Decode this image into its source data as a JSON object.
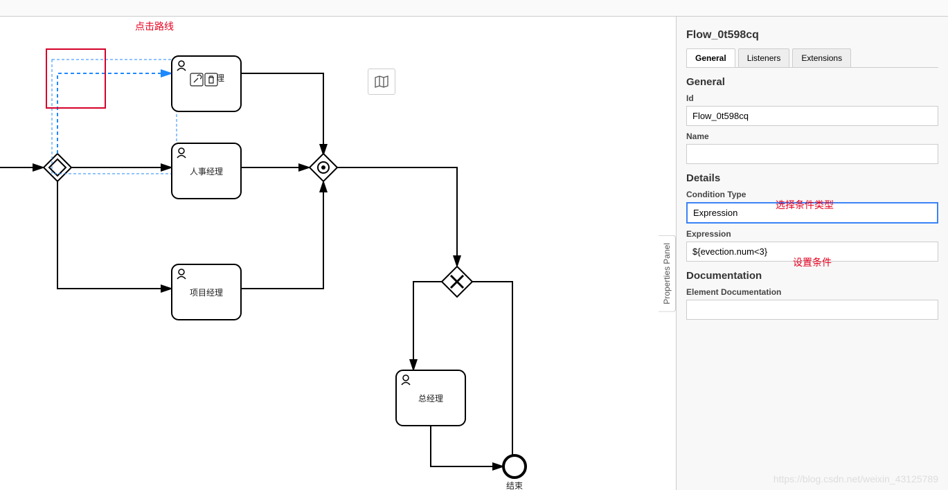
{
  "annotations": {
    "click_route": "点击路线",
    "choose_condition_type": "选择条件类型",
    "set_condition": "设置条件"
  },
  "panel_title": "Flow_0t598cq",
  "tabs": {
    "general": "General",
    "listeners": "Listeners",
    "extensions": "Extensions"
  },
  "side_tab": "Properties Panel",
  "general": {
    "section": "General",
    "id_label": "Id",
    "id_value": "Flow_0t598cq",
    "name_label": "Name",
    "name_value": ""
  },
  "details": {
    "section": "Details",
    "condition_type_label": "Condition Type",
    "condition_type_value": "Expression",
    "expression_label": "Expression",
    "expression_value": "${evection.num<3}"
  },
  "documentation": {
    "section": "Documentation",
    "label": "Element Documentation",
    "value": ""
  },
  "diagram": {
    "tasks": {
      "top": "理",
      "hr": "人事经理",
      "pm": "项目经理",
      "gm": "总经理"
    },
    "end_label": "结束"
  },
  "watermark": "https://blog.csdn.net/weixin_43125789"
}
